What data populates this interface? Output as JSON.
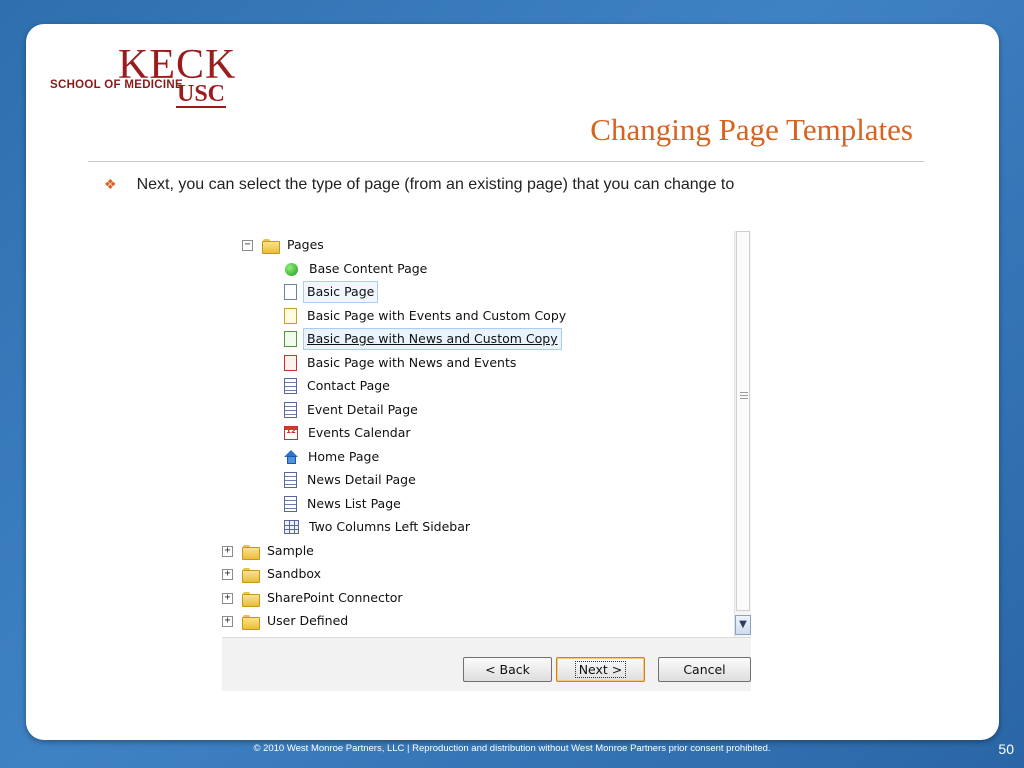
{
  "logo": {
    "keck": "KECK",
    "school": "SCHOOL OF MEDICINE",
    "usc": "USC"
  },
  "slide": {
    "title": "Changing Page Templates",
    "bullet": "Next, you can select the type of page (from an existing page) that you can change to"
  },
  "tree": {
    "root": {
      "label": "Pages",
      "expander": "−"
    },
    "children": [
      {
        "label": "Base Content Page",
        "icon": "green-circle-icon"
      },
      {
        "label": "Basic Page",
        "icon": "blank-page-icon",
        "state": "selected"
      },
      {
        "label": "Basic Page with Events and Custom Copy",
        "icon": "yellow-page-icon"
      },
      {
        "label": "Basic Page with News and Custom Copy",
        "icon": "green-page-icon",
        "state": "hover"
      },
      {
        "label": "Basic Page with News and Events",
        "icon": "red-page-icon"
      },
      {
        "label": "Contact Page",
        "icon": "lined-page-icon"
      },
      {
        "label": "Event Detail Page",
        "icon": "lined-page-icon"
      },
      {
        "label": "Events Calendar",
        "icon": "calendar-icon",
        "icon_text": "12"
      },
      {
        "label": "Home Page",
        "icon": "home-icon"
      },
      {
        "label": "News Detail Page",
        "icon": "lined-page-icon"
      },
      {
        "label": "News List Page",
        "icon": "lined-page-icon"
      },
      {
        "label": "Two Columns Left Sidebar",
        "icon": "grid-page-icon"
      }
    ],
    "siblings": [
      {
        "label": "Sample",
        "expander": "+"
      },
      {
        "label": "Sandbox",
        "expander": "+"
      },
      {
        "label": "SharePoint Connector",
        "expander": "+"
      },
      {
        "label": "User Defined",
        "expander": "+"
      }
    ]
  },
  "buttons": {
    "back": "< Back",
    "next": "Next >",
    "cancel": "Cancel"
  },
  "footer": {
    "text": "© 2010 West Monroe Partners, LLC  |  Reproduction and distribution without West Monroe Partners prior consent prohibited.",
    "page_number": "50"
  },
  "colors": {
    "accent": "#d9621e",
    "brand": "#9b1c1c",
    "background": "#2e6fae"
  }
}
